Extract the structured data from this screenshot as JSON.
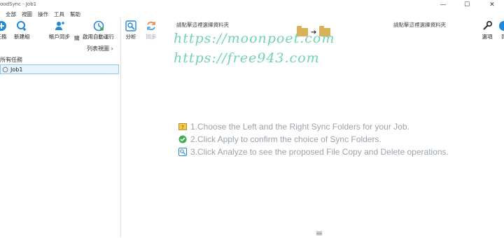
{
  "window": {
    "title": "oodSync - Job1",
    "min_glyph": "—",
    "max_glyph": "☐",
    "close_glyph": "✕"
  },
  "menu": [
    "全部",
    "視圖",
    "操作",
    "工具",
    "幫助"
  ],
  "toolbar": {
    "tasks_label": "任務",
    "new_group_label": "新建組",
    "account_sync_label": "帳戶同步",
    "close_label": "關",
    "enable_auto_label": "啟用自動運行",
    "analyze_label": "分析",
    "sync_label": "同步",
    "options_label": "選項",
    "extra_label": "同"
  },
  "folders": {
    "left_hint": "請點擊這裡選擇資料夾",
    "right_hint": "請點擊這裡選擇資料夾",
    "arrow": "➔"
  },
  "sidebar": {
    "list_view_label": "列表視圖 ›",
    "all_jobs_label": "所有任務",
    "jobs": [
      {
        "name": "Job1"
      }
    ]
  },
  "watermark": {
    "line1": "https://moonpoet.com",
    "line2": "https://free943.com"
  },
  "steps": [
    {
      "icon": "folder-question-icon",
      "text": "1.Choose the Left and the Right Sync Folders for your Job."
    },
    {
      "icon": "check-circle-icon",
      "text": "2.Click Apply to confirm the choice of Sync Folders."
    },
    {
      "icon": "analyze-icon",
      "text": "3.Click Analyze to see the proposed File Copy and Delete operations."
    }
  ],
  "colors": {
    "accent": "#1e88d9",
    "watermark": "#6fd3b6",
    "hint_text": "#9aa3ab",
    "selected_row": "#e7f3fd"
  }
}
